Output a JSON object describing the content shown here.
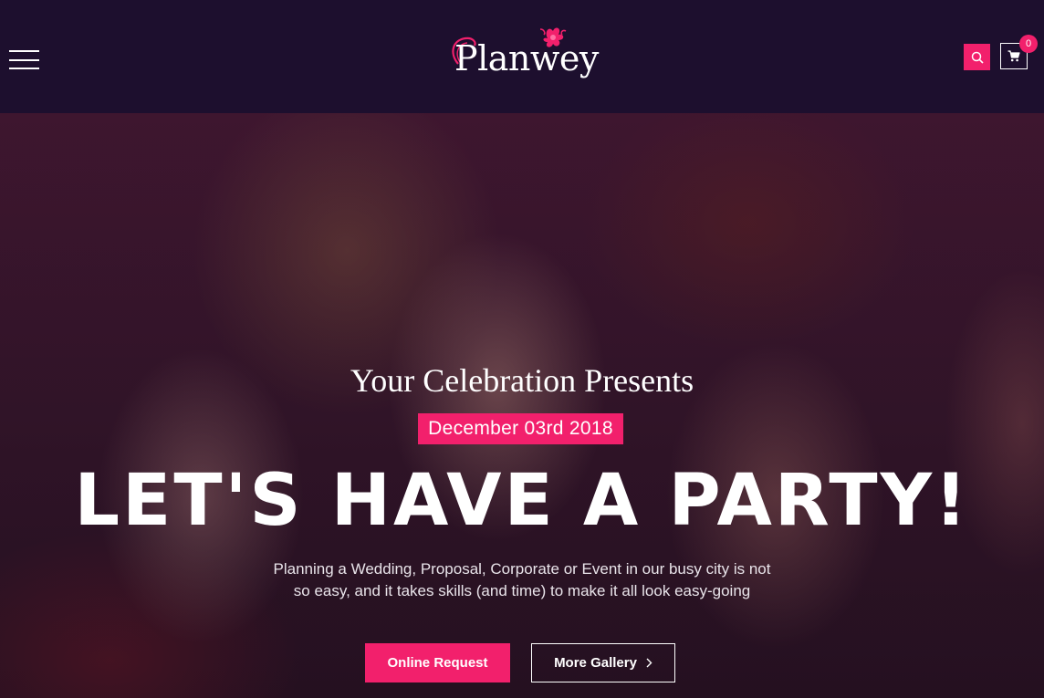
{
  "header": {
    "logo_text": "Planwey",
    "cart_count": "0"
  },
  "hero": {
    "subtitle": "Your Celebration Presents",
    "date": "December 03rd 2018",
    "title_main": "LET'S HAVE A ",
    "title_highlight": "PARTY!",
    "description": "Planning a Wedding, Proposal, Corporate or Event in our busy city is not so easy, and it takes skills (and time) to make it all look easy-going",
    "primary_button": "Online Request",
    "secondary_button": "More Gallery"
  },
  "icons": {
    "menu": "hamburger-icon",
    "search": "search-icon",
    "cart": "cart-icon",
    "chevron": "chevron-right-icon"
  },
  "colors": {
    "accent": "#f2206c",
    "header_bg": "#1d0f2e",
    "text": "#ffffff"
  }
}
